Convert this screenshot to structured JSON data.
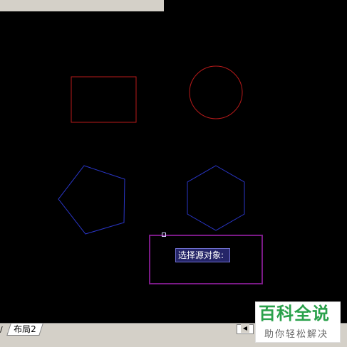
{
  "layout_tabs": {
    "previous_fragment": "/",
    "layout2_label": "布局2"
  },
  "prompt": {
    "text": "选择源对象:"
  },
  "watermark": {
    "title": "百科全说",
    "subtitle": "助你轻松解决"
  },
  "colors": {
    "canvas_background": "#000000",
    "red_shapes": "#b81a1a",
    "blue_shapes": "#2a36c8",
    "selection_box": "#7a1a86",
    "tooltip_background": "#252568"
  },
  "icons": {
    "scroll_left": "triangle-left"
  }
}
